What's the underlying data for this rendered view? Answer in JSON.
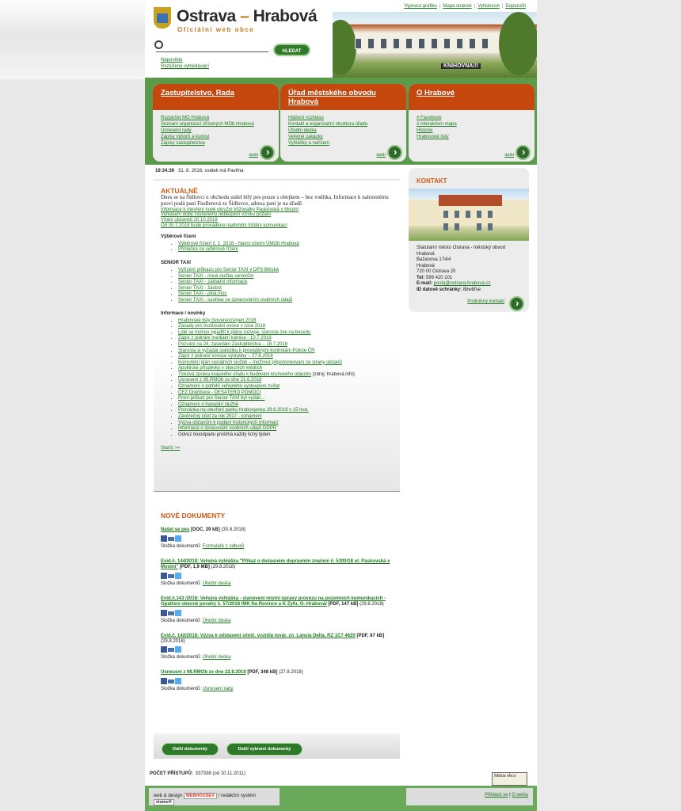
{
  "header": {
    "title_left": "Ostrava",
    "title_dash": "–",
    "title_right": "Hrabová",
    "subtitle": "Oficiální web obce",
    "top_links": [
      "Vypnout grafiku",
      "Mapa stránek",
      "Vytisknout",
      "Doporučit"
    ],
    "photo_label": "KNIHOVNA!!!"
  },
  "search": {
    "placeholder": "",
    "button": "HLEDAT",
    "help": "Nápověda",
    "advanced": "Rozšířené vyhledávání"
  },
  "boxes": [
    {
      "title": "Zastupitelstvo, Rada",
      "items": [
        "Rozpočet MO Hrabová",
        "Seznam organizací zřízených MOb Hrabová",
        "Usnesení rady",
        "Zápisy výborů a komisí",
        "Zápisy zastupitelstva"
      ],
      "more": "další"
    },
    {
      "title": "Úřad městského obvodu Hrabová",
      "items": [
        "Hlášení rozhlasu",
        "Kontakt a organizační struktura úřadu",
        "Úřední deska",
        "Veřejné zakázky",
        "Vyhlášky a nařízení"
      ],
      "more": "další"
    },
    {
      "title": "O Hrabové",
      "items": [
        "# Facebook",
        "# interaktivní mapa",
        "Historie",
        "Hrabovské listy"
      ],
      "more": "další"
    }
  ],
  "datetime": {
    "time": "19:34:39",
    "text": "31. 8. 2018, svátek má Pavlína"
  },
  "news": {
    "heading": "AKTUÁLNĚ",
    "lead": "Dnes se na Šídlovci u obchodu našel bílý pes pouze s obojkem – bez vodítka. Informace k nalezenému psovi podá paní Fiedlerová ze Šídlovce, adresa paní je na úřadě.",
    "links": [
      "Informace k otevření nové okružní křižovatky Paskovská x Mostní",
      "Vyhlášení doby zvýšeného nebezpečí vzniku požáru",
      "Vítání občánků 20.10.2018",
      "Od 30.7.2018 bude prováděno nadlimitní čištění komunikací"
    ],
    "tenders_title": "Výběrové řízení",
    "tenders": [
      "Výběrové řízení č. 1_2018 - hlavní účetní ÚMOb Hrabová",
      "Přihláška na výběrové řízení"
    ],
    "taxi_title": "SENIOR TAXI",
    "taxi": [
      "Vyřízení průkazu pro Senior TAXI v DPS Bělská",
      "Senior TAXI - nová služba seniorům",
      "Senior TAXI - základní informace",
      "Senior TAXI - žádost",
      "Senior TAXI - plná moc",
      "Senior TAXI - souhlas se zpracováním osobních údajů"
    ],
    "info_title": "Informace / novinky",
    "info": [
      "Hrabovské listy červenec/srpen 2018",
      "Zásady pro moštování ovoce v roce 2018",
      "Lidé se mohou vyjádřit k plánu rozvoje, starosta zve na besedu",
      "Zápis z jednání mediální komise - 10.7.2018",
      "Pozvání na 24. zasedání Zastupitelstva – 18.7.2018",
      "Starosta si vyžádal statistiku k prováděným kontrolám Policie ČR",
      "Zápis z jednání komise výstavby – 27.6.2018",
      "Komunitní plán sociálních služeb – možnost připomínkování ze strany občanů",
      "Apolitické příspěvky v obecních médiích",
      "Tisková zpráva krajského úřadu k budování kruhového objezdu",
      "Usnesení z 95.RMOb ze dne 21.6.2018",
      "Oznámení o potřebí veřejného vystoupení zvířat",
      "ČEZ Distribuce - DESATERO POMOCI",
      "První průkaz pro Senior TAXI byl vydán...",
      "Oznámení o havarijní službě",
      "Pozvánka na otevření parku Hrabovjanka 29.6.2018 v 15 hod.",
      "Závěrečný účet za rok 2017 - oznámení",
      "Výzva občanům k podání historických informací",
      "Informace o zpracování osobních údajů GDPR"
    ],
    "info_source": "(zdroj: hrabová.info)",
    "info_plain": "Odvoz bioodpadu probíhá každý lichý týden",
    "older": "Starší >>"
  },
  "docs": {
    "heading": "NOVÉ DOKUMENTY",
    "folder_label": "Složka dokumentů:",
    "items": [
      {
        "title": "Našel se pes",
        "meta": "[DOC, 29 kB]",
        "date": "(30.8.2018)",
        "folder": "Formuláře z odborů"
      },
      {
        "title": "Evid.č. 144/2018: Veřejná vyhláška \"Příkaz o dočasném dopravním značení č. 5300/18 ul. Paskovská x Mostní\"",
        "meta": "[PDF, 1,9 MB]",
        "date": "(29.8.2018)",
        "folder": "Úřední deska"
      },
      {
        "title": "Evid.č.143 /2018: Veřejná vyhláška - stanovení místní úpravy provozu na pozemních komunikacích - Opatření obecné povahy č. 57/2018 /MK Na Rovince a K Zyfu, O.-Hrabová/",
        "meta": "[PDF, 147 kB]",
        "date": "(29.8.2018)",
        "folder": "Úřední deska"
      },
      {
        "title": "Evid.č. 142/2018: Výzva k odstavení silnič. vozidla továr. zn. Lancia Delta, RZ 1C7 4620",
        "meta": "[PDF, 87 kB]",
        "date": "(29.8.2018)",
        "folder": "Úřední deska"
      },
      {
        "title": "Usnesení z 98.RMOb ze dne 22.8.2018",
        "meta": "[PDF, 348 kB]",
        "date": "(27.8.2018)",
        "folder": "Usnesení rady"
      }
    ],
    "btn_more": "Další dokumenty",
    "btn_selected": "Další vybrané dokumenty"
  },
  "counter": {
    "label": "POČET PŘÍSTUPŮ:",
    "value": "337338",
    "since": "(od 10.11.2011)"
  },
  "badge": "Města obce",
  "footer": {
    "left_pre": "web & design",
    "webhouse": "WEBHOUSE®",
    "left_mid": "/ redakční systém",
    "vismo": "vismo®",
    "login": "Přihlásit se",
    "about": "O webu"
  },
  "contact": {
    "heading": "KONTAKT",
    "org": "Statutární město Ostrava - městský obvod Hrabová",
    "street": "Bažanova 174/4",
    "city": "Hrabová",
    "zip": "720 00 Ostrava 20",
    "tel_label": "Tel:",
    "tel": "599 420 101",
    "email_label": "E-mail:",
    "email": "posta@ostrava-hrabova.cz",
    "ds_label": "ID datové schránky:",
    "ds": "8bwbfse",
    "more": "Podrobný kontakt"
  },
  "colors": {
    "green": "#2f7a2a",
    "orange": "#c5470d",
    "band": "#5b9a4a",
    "link": "#1c7a1c"
  }
}
